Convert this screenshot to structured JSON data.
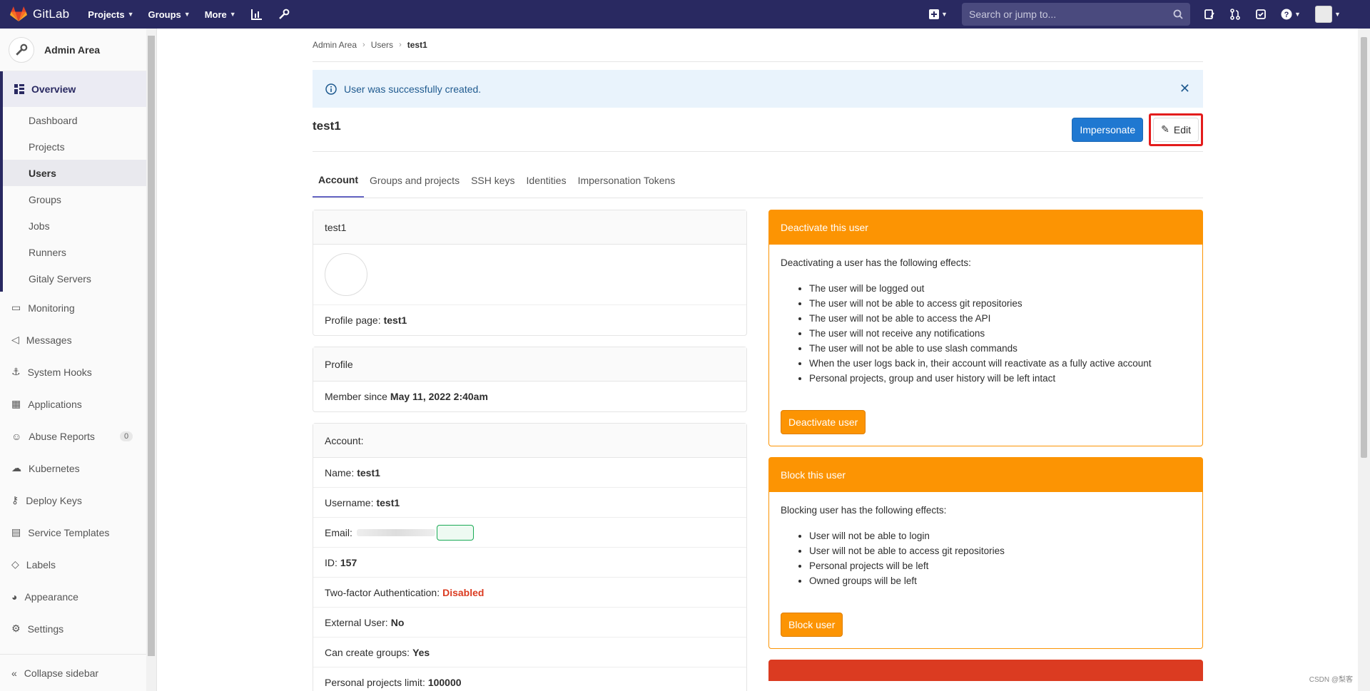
{
  "navbar": {
    "brand": "GitLab",
    "links": [
      {
        "label": "Projects"
      },
      {
        "label": "Groups"
      },
      {
        "label": "More"
      }
    ],
    "search_placeholder": "Search or jump to..."
  },
  "sidebar": {
    "title": "Admin Area",
    "overview_label": "Overview",
    "sub_items": [
      "Dashboard",
      "Projects",
      "Users",
      "Groups",
      "Jobs",
      "Runners",
      "Gitaly Servers"
    ],
    "items": [
      {
        "label": "Monitoring",
        "icon": "monitor-icon"
      },
      {
        "label": "Messages",
        "icon": "megaphone-icon"
      },
      {
        "label": "System Hooks",
        "icon": "hook-icon"
      },
      {
        "label": "Applications",
        "icon": "apps-icon"
      },
      {
        "label": "Abuse Reports",
        "icon": "face-icon",
        "badge": "0"
      },
      {
        "label": "Kubernetes",
        "icon": "cloud-icon"
      },
      {
        "label": "Deploy Keys",
        "icon": "key-icon"
      },
      {
        "label": "Service Templates",
        "icon": "template-icon"
      },
      {
        "label": "Labels",
        "icon": "label-icon"
      },
      {
        "label": "Appearance",
        "icon": "palette-icon"
      },
      {
        "label": "Settings",
        "icon": "gear-icon"
      }
    ],
    "collapse_label": "Collapse sidebar"
  },
  "breadcrumb": [
    "Admin Area",
    "Users",
    "test1"
  ],
  "alert": {
    "message": "User was successfully created."
  },
  "page": {
    "title": "test1",
    "impersonate_label": "Impersonate",
    "edit_label": "Edit"
  },
  "tabs": [
    "Account",
    "Groups and projects",
    "SSH keys",
    "Identities",
    "Impersonation Tokens"
  ],
  "user_card": {
    "header": "test1",
    "profile_page_label": "Profile page:",
    "profile_page_value": "test1"
  },
  "profile_card": {
    "header": "Profile",
    "member_since_label": "Member since",
    "member_since_value": "May 11, 2022 2:40am"
  },
  "account_card": {
    "header": "Account:",
    "rows": [
      {
        "label": "Name:",
        "value": "test1"
      },
      {
        "label": "Username:",
        "value": "test1"
      },
      {
        "label": "Email:",
        "value": ""
      },
      {
        "label": "ID:",
        "value": "157"
      },
      {
        "label": "Two-factor Authentication:",
        "value": "Disabled"
      },
      {
        "label": "External User:",
        "value": "No"
      },
      {
        "label": "Can create groups:",
        "value": "Yes"
      },
      {
        "label": "Personal projects limit:",
        "value": "100000"
      }
    ]
  },
  "deactivate_card": {
    "header": "Deactivate this user",
    "intro": "Deactivating a user has the following effects:",
    "effects": [
      "The user will be logged out",
      "The user will not be able to access git repositories",
      "The user will not be able to access the API",
      "The user will not receive any notifications",
      "The user will not be able to use slash commands",
      "When the user logs back in, their account will reactivate as a fully active account",
      "Personal projects, group and user history will be left intact"
    ],
    "button_label": "Deactivate user"
  },
  "block_card": {
    "header": "Block this user",
    "intro": "Blocking user has the following effects:",
    "effects": [
      "User will not be able to login",
      "User will not be able to access git repositories",
      "Personal projects will be left",
      "Owned groups will be left"
    ],
    "button_label": "Block user"
  },
  "watermark": "CSDN @梨客",
  "colors": {
    "navbar": "#292961",
    "primary": "#1f78d1",
    "warning": "#fc9403",
    "danger": "#db3b21"
  }
}
